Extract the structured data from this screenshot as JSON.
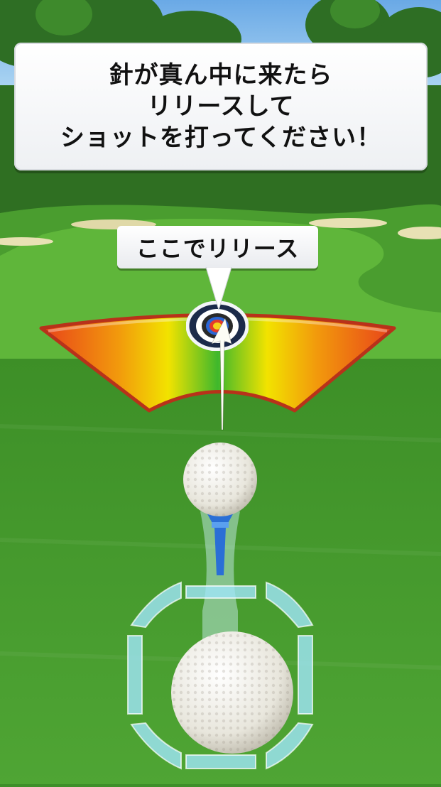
{
  "instruction": {
    "lines": [
      "針が真ん中に来たら",
      "リリースして",
      "ショットを打ってください！"
    ]
  },
  "release_callout": {
    "label": "ここでリリース"
  },
  "icons": {
    "target": "bullseye-target-icon",
    "needle": "aim-needle-icon",
    "swing_ring": "swing-ring-icon"
  },
  "colors": {
    "meter_center": "#3fb82c",
    "meter_mid": "#f2e300",
    "meter_edge": "#e8421a",
    "grass": "#3f8f2a"
  }
}
